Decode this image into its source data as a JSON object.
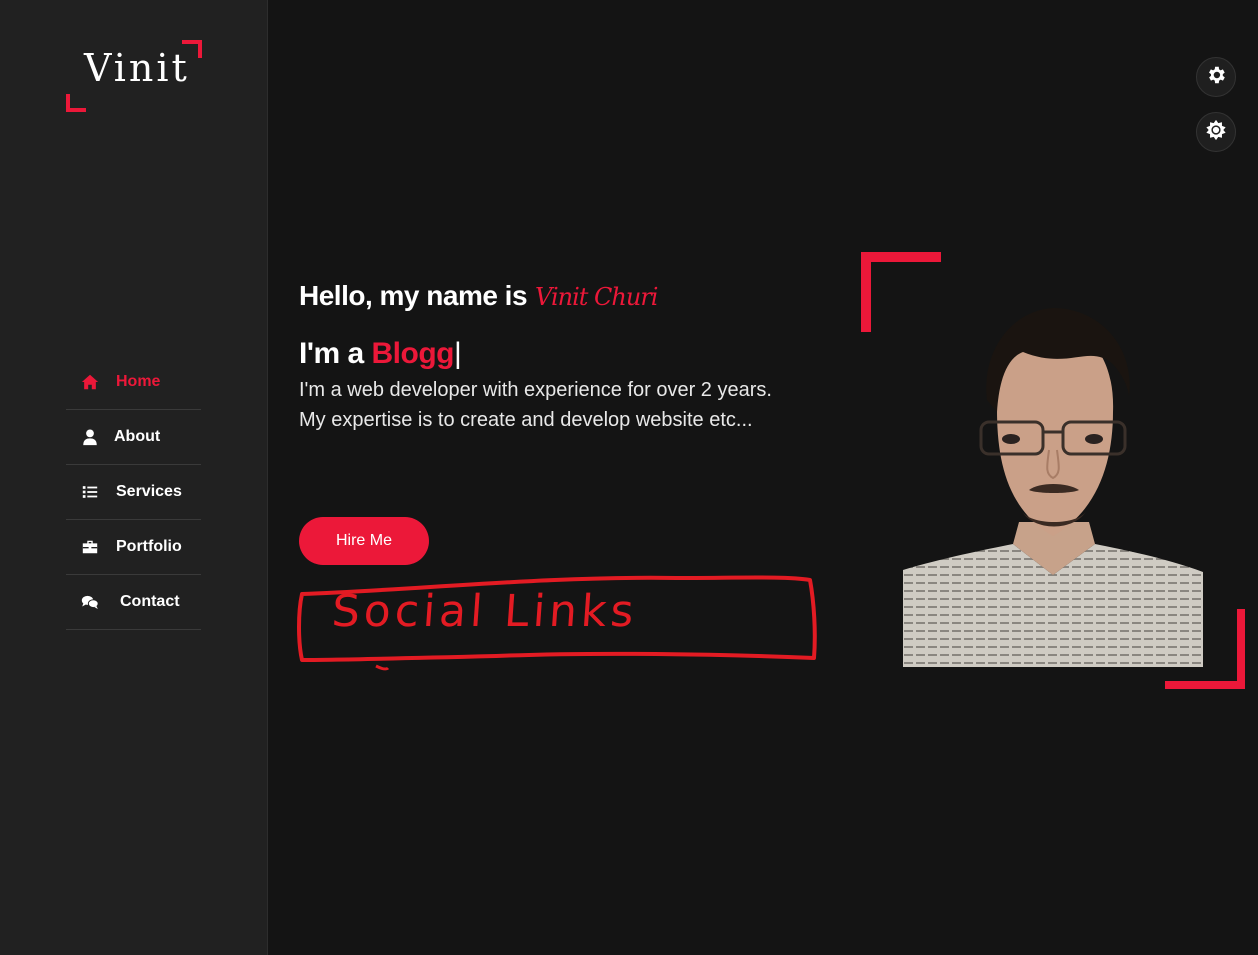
{
  "brand": {
    "logo_text": "Vinit"
  },
  "nav": {
    "items": [
      {
        "label": "Home",
        "icon": "home-icon",
        "active": true
      },
      {
        "label": "About",
        "icon": "user-icon",
        "active": false
      },
      {
        "label": "Services",
        "icon": "list-icon",
        "active": false
      },
      {
        "label": "Portfolio",
        "icon": "briefcase-icon",
        "active": false
      },
      {
        "label": "Contact",
        "icon": "comments-icon",
        "active": false
      }
    ]
  },
  "top_controls": [
    {
      "icon": "gear-icon"
    },
    {
      "icon": "theme-sun-icon"
    }
  ],
  "hero": {
    "greeting": "Hello, my name is",
    "name": "Vinit Churi",
    "role_prefix": "I'm a",
    "role_typed": "Blogg",
    "cursor": "|",
    "description_line1": "I'm a web developer with experience for over 2 years.",
    "description_line2": "My expertise is to create and develop website etc...",
    "hire_button": "Hire Me"
  },
  "annotation": {
    "text": "Social Links"
  },
  "colors": {
    "accent": "#ec1839",
    "background": "#141414",
    "sidebar": "#212121",
    "annotation": "#e31b23"
  }
}
